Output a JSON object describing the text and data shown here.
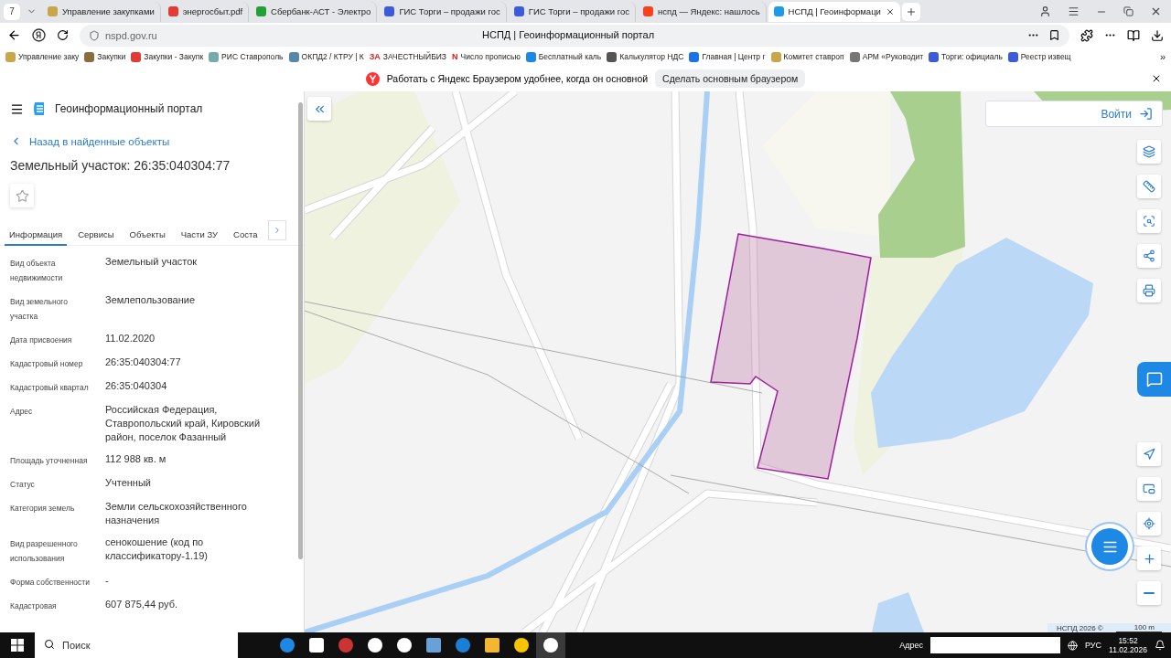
{
  "browser": {
    "tab_count": "7",
    "tabs": [
      {
        "title": "Управление закупками",
        "selected": false
      },
      {
        "title": "энергосбыт.pdf",
        "selected": false
      },
      {
        "title": "Сбербанк-АСТ - Электро",
        "selected": false
      },
      {
        "title": "ГИС Торги – продажи гос",
        "selected": false
      },
      {
        "title": "ГИС Торги – продажи гос",
        "selected": false
      },
      {
        "title": "нспд — Яндекс: нашлось",
        "selected": false
      },
      {
        "title": "НСПД | Геоинформаци",
        "selected": true
      }
    ],
    "url": "nspd.gov.ru",
    "page_title": "НСПД | Геоинформационный портал",
    "bookmarks": [
      {
        "label": "Управление заку"
      },
      {
        "label": "Закупки"
      },
      {
        "label": "Закупки - Закупк"
      },
      {
        "label": "РИС Ставрополь"
      },
      {
        "label": "ОКПД2 / КТРУ | К"
      },
      {
        "label": "ЗАЧЕСТНЫЙБИЗ",
        "badge": "ЗА"
      },
      {
        "label": "Число прописью",
        "badge": "N"
      },
      {
        "label": "Бесплатный каль"
      },
      {
        "label": "Калькулятор НДС"
      },
      {
        "label": "Главная | Центр г"
      },
      {
        "label": "Комитет ставроп"
      },
      {
        "label": "АРМ «Руководит"
      },
      {
        "label": "Торги: официаль"
      },
      {
        "label": "Реестр извещ"
      }
    ],
    "more_bookmarks": "»",
    "infobar": {
      "text": "Работать с Яндекс Браузером удобнее, когда он основной",
      "button": "Сделать основным браузером"
    }
  },
  "portal": {
    "title": "Геоинформационный портал",
    "back_link": "Назад в найденные объекты",
    "object_title": "Земельный участок: 26:35:040304:77",
    "favorite": false,
    "tabs": [
      {
        "label": "Информация",
        "selected": true
      },
      {
        "label": "Сервисы",
        "selected": false
      },
      {
        "label": "Объекты",
        "selected": false
      },
      {
        "label": "Части ЗУ",
        "selected": false
      },
      {
        "label": "Соста",
        "selected": false
      }
    ],
    "properties": [
      {
        "label": "Вид объекта недвижимости",
        "value": "Земельный участок"
      },
      {
        "label": "Вид земельного участка",
        "value": "Землепользование"
      },
      {
        "label": "Дата присвоения",
        "value": "11.02.2020"
      },
      {
        "label": "Кадастровый номер",
        "value": "26:35:040304:77"
      },
      {
        "label": "Кадастровый квартал",
        "value": "26:35:040304"
      },
      {
        "label": "Адрес",
        "value": "Российская Федерация, Ставропольский край, Кировский район, поселок Фазанный"
      },
      {
        "label": "Площадь уточненная",
        "value": "112 988 кв. м"
      },
      {
        "label": "Статус",
        "value": "Учтенный"
      },
      {
        "label": "Категория земель",
        "value": "Земли сельскохозяйственного назначения"
      },
      {
        "label": "Вид разрешенного использования",
        "value": "сенокошение (код по классификатору-1.19)"
      },
      {
        "label": "Форма собственности",
        "value": "-"
      },
      {
        "label": "Кадастровая",
        "value": "607 875,44 руб."
      }
    ]
  },
  "map": {
    "login": "Войти",
    "copyright": "НСПД 2026 ©",
    "scale": "100 m"
  },
  "taskbar": {
    "search_placeholder": "Поиск",
    "apps": [
      {
        "active": false
      },
      {
        "active": false
      },
      {
        "active": false
      },
      {
        "active": false
      },
      {
        "active": false
      },
      {
        "active": false
      },
      {
        "active": false
      },
      {
        "active": false
      },
      {
        "active": false
      },
      {
        "active": true
      }
    ],
    "address_label": "Адрес",
    "language": "РУС",
    "time": "15:52",
    "date": "11.02.2026"
  }
}
